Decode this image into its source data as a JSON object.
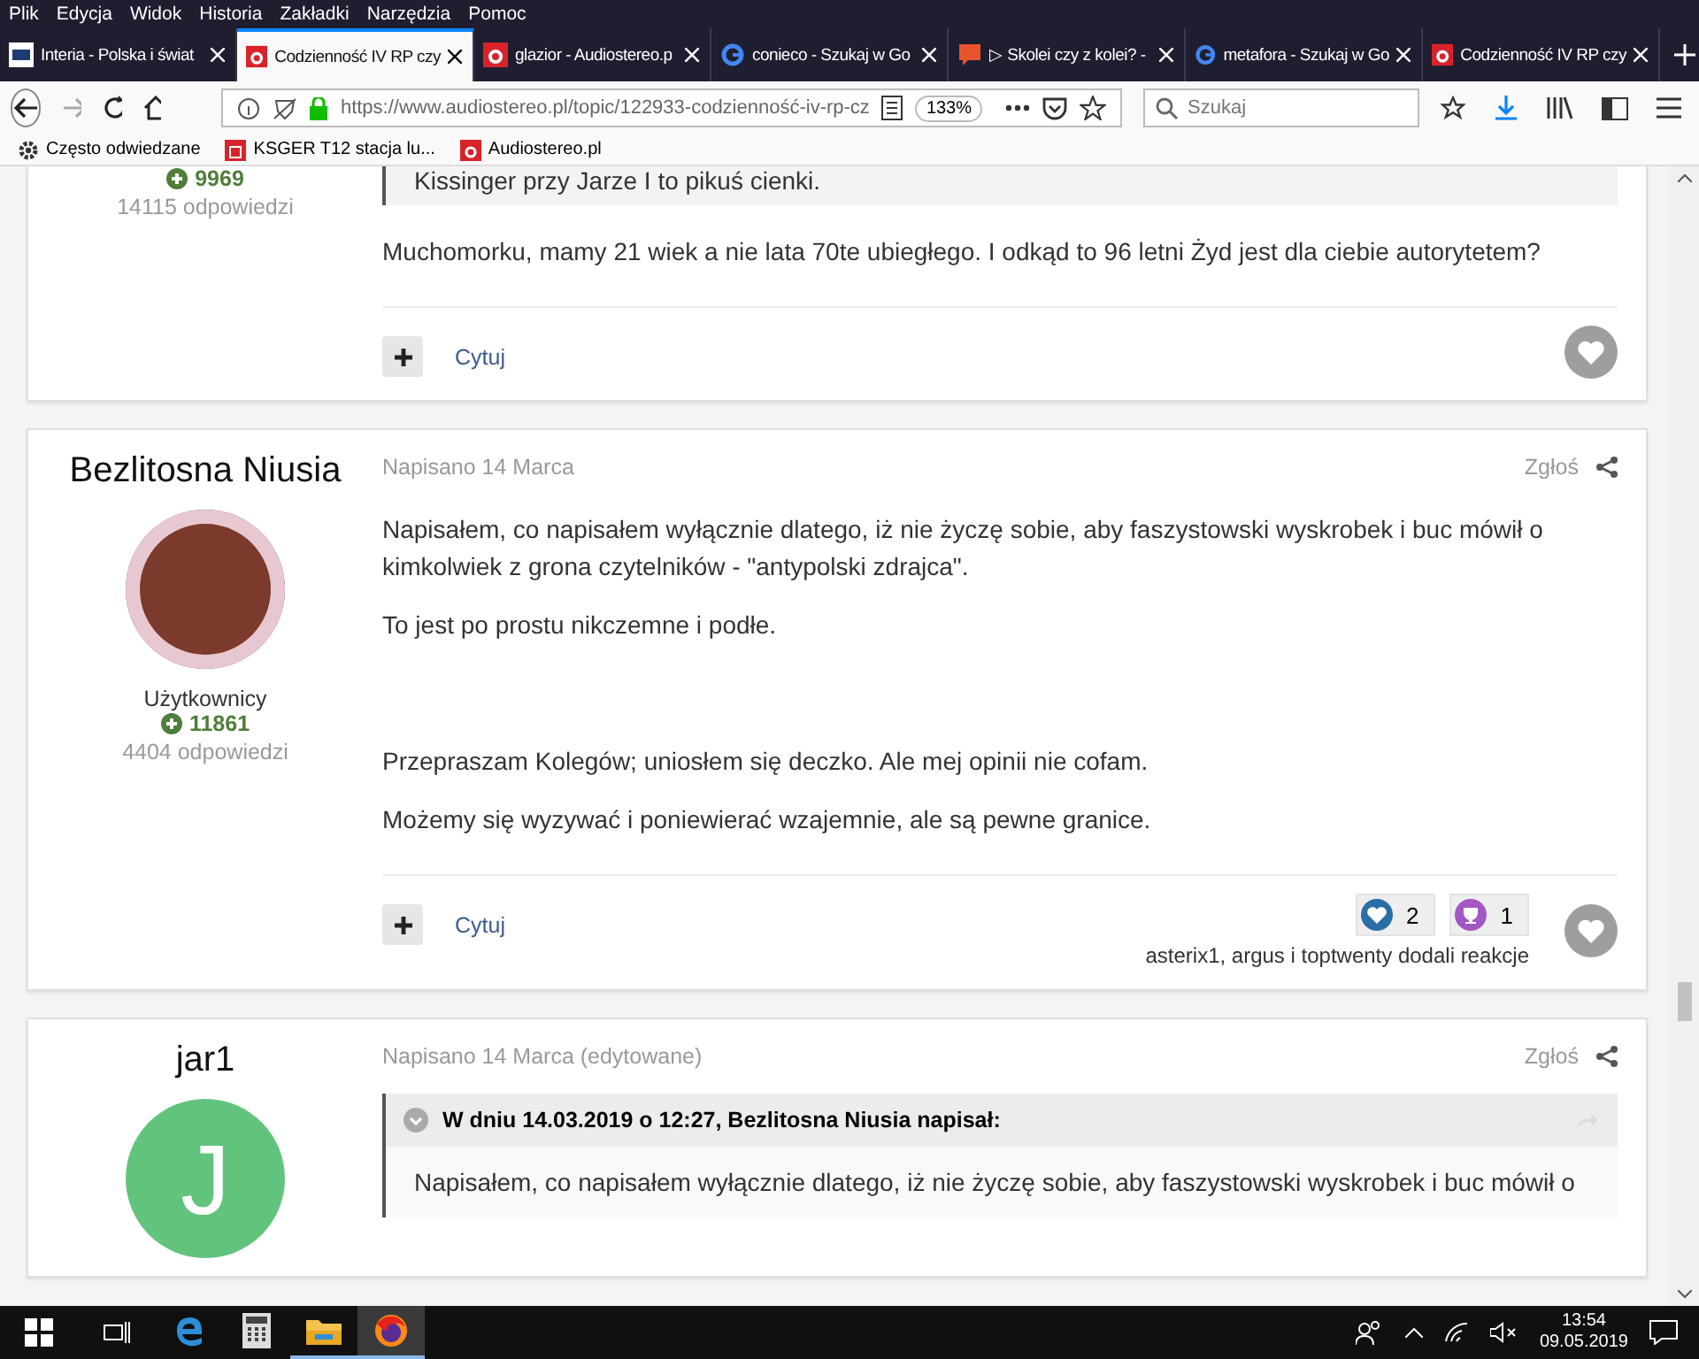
{
  "menu": [
    "Plik",
    "Edycja",
    "Widok",
    "Historia",
    "Zakładki",
    "Narzędzia",
    "Pomoc"
  ],
  "tabs": [
    {
      "title": "Interia - Polska i świat",
      "kind": "int",
      "selected": false
    },
    {
      "title": "Codzienność IV RP czy",
      "kind": "a",
      "selected": true
    },
    {
      "title": "glazior - Audiostereo.p",
      "kind": "a",
      "selected": false
    },
    {
      "title": "conieco - Szukaj w Go",
      "kind": "g",
      "selected": false
    },
    {
      "title": "▷ Skolei czy z kolei? -",
      "kind": "q",
      "selected": false
    },
    {
      "title": "metafora - Szukaj w Go",
      "kind": "g",
      "selected": false
    },
    {
      "title": "Codzienność IV RP czy",
      "kind": "a",
      "selected": false
    }
  ],
  "address": {
    "url": "https://www.audiostereo.pl/topic/122933-codzienność-iv-rp-cz",
    "zoom": "133%"
  },
  "search": {
    "placeholder": "Szukaj"
  },
  "bookmarks": [
    {
      "label": "Często odwiedzane",
      "kind": "gear"
    },
    {
      "label": "KSGER T12 stacja lu...",
      "kind": "shop"
    },
    {
      "label": "Audiostereo.pl",
      "kind": "a"
    }
  ],
  "posts": [
    {
      "reputation": "9969",
      "replies": "14115 odpowiedzi",
      "quote_text": "Kissinger przy Jarze I to pikuś cienki.",
      "paragraphs": [
        {
          "text": "Muchomorku, mamy 21 wiek a nie lata 70te ubiegłego. I  odkąd to 96 letni Żyd jest dla ciebie autorytetem?",
          "spaced": false
        }
      ],
      "quote_action": "Cytuj"
    },
    {
      "author": "Bezlitosna Niusia",
      "avatar": {
        "kind": "photo"
      },
      "group": "Użytkownicy",
      "reputation": "11861",
      "replies": "4404 odpowiedzi",
      "date": "Napisano 14 Marca",
      "report": "Zgłoś",
      "paragraphs": [
        {
          "text": "Napisałem, co napisałem wyłącznie dlatego, iż nie życzę sobie, aby faszystowski wyskrobek i buc mówił o kimkolwiek z grona czytelników - \"antypolski zdrajca\".",
          "spaced": false
        },
        {
          "text": "To jest po prostu nikczemne i podłe.",
          "spaced": false
        },
        {
          "text": "Przepraszam Kolegów; uniosłem się deczko. Ale mej opinii nie cofam.",
          "spaced": true
        },
        {
          "text": "Możemy się wyzywać i poniewierać wzajemnie, ale są pewne granice.",
          "spaced": false
        }
      ],
      "quote_action": "Cytuj",
      "reactions": [
        {
          "kind": "like",
          "count": "2"
        },
        {
          "kind": "trophy",
          "count": "1"
        }
      ],
      "reactions_text": "asterix1, argus i toptwenty dodali reakcje"
    },
    {
      "author": "jar1",
      "avatar": {
        "kind": "letter",
        "letter": "J",
        "color": "#62c47c"
      },
      "date": "Napisano 14 Marca (edytowane)",
      "report": "Zgłoś",
      "quote_header": "W dniu 14.03.2019 o 12:27, Bezlitosna Niusia napisał:",
      "quote_text": "Napisałem, co napisałem wyłącznie dlatego, iż nie życzę sobie, aby faszystowski wyskrobek i buc mówił o"
    }
  ],
  "taskbar": {
    "apps": [
      {
        "kind": "edge",
        "running": false,
        "selected": false
      },
      {
        "kind": "calculator",
        "running": false,
        "selected": false
      },
      {
        "kind": "explorer",
        "running": true,
        "selected": false
      },
      {
        "kind": "firefox",
        "running": true,
        "selected": true
      }
    ],
    "time": "13:54",
    "date": "09.05.2019"
  }
}
